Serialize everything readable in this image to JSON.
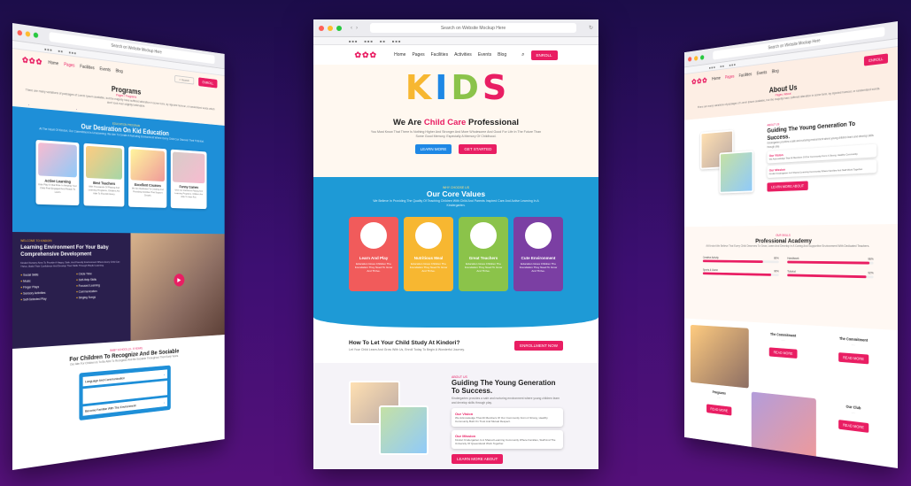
{
  "urls": {
    "left": "Search on Website Mockup Here",
    "center": "Search on Website Mockup Here",
    "right": "Search on Website Mockup Here"
  },
  "nav": [
    "Home",
    "Pages",
    "Facilities",
    "Activities",
    "Events",
    "Blog"
  ],
  "nav_right": [
    "Home",
    "Pages",
    "Facilities",
    "Events",
    "Blog"
  ],
  "enroll": "ENROLL",
  "search_placeholder": "Search",
  "left": {
    "title": "Programs",
    "crumb": "Pages / Programs",
    "intro": "There are many variations of passages of Lorem Ipsum available, but the majority have suffered alteration in some form, by injected humour, or randomised words which don't look even slightly believable.",
    "eyebrow": "EDUCATION PROGRAM",
    "section_title": "Our Desiration On Kid Education",
    "section_sub": "At The Heart Of Kindori, Our Commitment Is Unwavering: We Aim To Create A Nurturing Environment Where Every Child Can Discover Their Potential.",
    "cards": [
      {
        "t": "Active Learning",
        "d": "Kids Play A Vital Role In Helping Your Child Feel Engaged And Ready To Learn."
      },
      {
        "t": "Best Teachers",
        "d": "With Thousands Of Playing And Learning Programs, Children Are Able To Flourish Every."
      },
      {
        "t": "Excellent Courses",
        "d": "We Are Dedicated To Creating And Providing Activities That Support Growth."
      },
      {
        "t": "Funny Games",
        "d": "With Our Interactive Playing And Learning Programs, Children Are Able To Have Fun."
      }
    ],
    "env_eyebrow": "WELCOME TO KINDORI",
    "env_title": "Learning Environment For Your Baby Comprehensive Development",
    "env_desc": "Kindori Nursery Aims To Provide A Happy, Safe, And Friendly Environment Where Every Child Can Thrive, Build Their Confidence And Develop Their Skills Through Playful Learning.",
    "list": [
      "Social Skills",
      "Circle Time",
      "Music",
      "Self-Help Skills",
      "Finger Plays",
      "Focused Learning",
      "Sensory Activities",
      "Communication",
      "Self-Selected Play",
      "Singing Songs"
    ],
    "bottom_eyebrow": "BABY SCHOOL (3 - 5 YEAR)",
    "bottom_title": "For Children To Recognize And Be Sociable",
    "bottom_sub": "Our Aim For Children Is To Be Able To Recognize And Be Sociable Throughout Their Early Years.",
    "faq": [
      "Language And Communication",
      "Become Familiar With The Environment"
    ]
  },
  "center": {
    "hero_letters": [
      "K",
      "I",
      "D",
      "S"
    ],
    "hero_title_a": "We Are ",
    "hero_title_b": "Child Care",
    "hero_title_c": " Professional",
    "hero_sub": "You Must Know That There Is Nothing Higher And Stronger And More Wholesome And Good For Life In The Future Than Some Good Memory, Especially A Memory Of Childhood.",
    "btn1": "LEARN MORE",
    "btn2": "GET STARTED",
    "values_eyebrow": "WHY CHOOSE US",
    "values_title": "Our Core Values",
    "values_sub": "We Believe In Providing The Quality Of Teaching Children With Child And Parents Inspired Care And Active Learning In A Kindergarten.",
    "values": [
      {
        "t": "Learn And Play",
        "c": "#f15b5b"
      },
      {
        "t": "Nutritious Meal",
        "c": "#f7b731"
      },
      {
        "t": "Great Teachers",
        "c": "#8bc34a"
      },
      {
        "t": "Cute Environment",
        "c": "#7b3fa3"
      }
    ],
    "value_desc": "Education Gives Children The Foundation They Need To Grow And Thrive.",
    "study_title": "How To Let Your Child Study At Kindori?",
    "study_sub": "Let Your Child Learn And Grow With Us, Enroll Today To Begin A Wonderful Journey.",
    "enroll_btn": "ENROLLMENT NOW",
    "about_eyebrow": "ABOUT US",
    "about_title": "Guiding The Young Generation To Success.",
    "about_desc": "Kindergarten provides a safe and nurturing environment where young children learn and develop skills through play.",
    "vision_t": "Our Vision",
    "vision_d": "We Acknowledge That All Members Of Our Community Form A Strong, Healthy Community Built On Trust And Mutual Respect.",
    "mission_t": "Our Mission",
    "mission_d": "Kindori Kindergarten Is A Shared Learning Community Where Families, Staff And The University Of Queensland Work Together.",
    "learn_btn": "LEARN MORE ABOUT"
  },
  "right": {
    "title": "About Us",
    "crumb": "Pages / About",
    "intro": "There are many variations of passages of Lorem Ipsum available, but the majority have suffered alteration in some form, by injected humour, or randomised words.",
    "about_eyebrow": "ABOUT US",
    "about_title": "Guiding The Young Generation To Success.",
    "about_desc": "Kindergarten provides a safe and nurturing environment where young children learn and develop skills through play.",
    "vision_t": "Our Vision",
    "vision_d": "We Acknowledge That All Members Of Our Community Form A Strong, Healthy Community.",
    "mission_t": "Our Mission",
    "mission_d": "Kindori Kindergarten Is A Shared Learning Community Where Families And Staff Work Together.",
    "learn_btn": "LEARN MORE ABOUT",
    "academy_eyebrow": "OUR SKILLS",
    "academy_title": "Professional Academy",
    "academy_sub": "At Kindori We Believe That Every Child Deserves To Grow, Learn And Develop In A Caring And Supportive Environment With Dedicated Teachers.",
    "skills": [
      {
        "n": "Creative Activity",
        "v": 0.8
      },
      {
        "n": "Handiwork",
        "v": 0.96
      },
      {
        "n": "Sports & Game",
        "v": 0.9
      },
      {
        "n": "Tutorial",
        "v": 0.92
      }
    ],
    "skill_labels": [
      "80%",
      "96%",
      "90%",
      "92%"
    ],
    "tiles": [
      {
        "t": "The Commitment"
      },
      {
        "t": "The Commitment"
      },
      {
        "t": "Programs"
      },
      {
        "t": "Our Club"
      }
    ],
    "read_more": "READ MORE"
  }
}
